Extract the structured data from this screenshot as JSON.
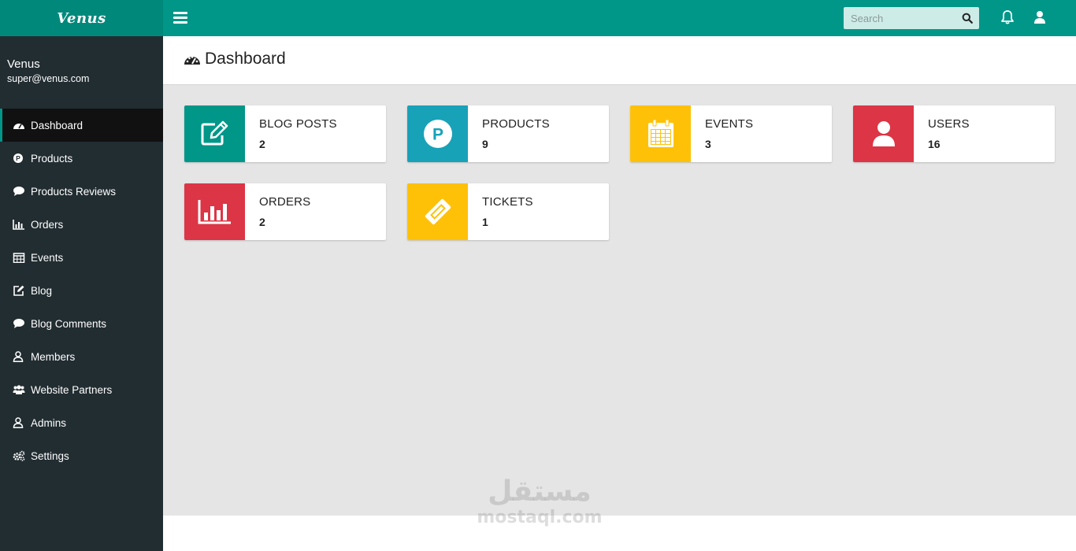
{
  "app": {
    "brand": "Venus"
  },
  "topbar": {
    "search_placeholder": "Search",
    "icons": [
      "menu-icon",
      "search-icon",
      "bell-icon",
      "user-icon"
    ]
  },
  "sidebar": {
    "user_name": "Venus",
    "user_email": "super@venus.com",
    "items": [
      {
        "label": "Dashboard",
        "icon": "dashboard-icon",
        "active": true
      },
      {
        "label": "Products",
        "icon": "product-icon"
      },
      {
        "label": "Products Reviews",
        "icon": "comment-icon"
      },
      {
        "label": "Orders",
        "icon": "chart-icon"
      },
      {
        "label": "Events",
        "icon": "calendar-icon"
      },
      {
        "label": "Blog",
        "icon": "edit-icon"
      },
      {
        "label": "Blog Comments",
        "icon": "comment-icon"
      },
      {
        "label": "Members",
        "icon": "user-icon"
      },
      {
        "label": "Website Partners",
        "icon": "users-icon"
      },
      {
        "label": "Admins",
        "icon": "user-icon"
      },
      {
        "label": "Settings",
        "icon": "gears-icon"
      }
    ]
  },
  "page": {
    "title": "Dashboard"
  },
  "cards": [
    {
      "label": "BLOG POSTS",
      "value": "2",
      "color": "#009688",
      "icon": "edit-icon"
    },
    {
      "label": "PRODUCTS",
      "value": "9",
      "color": "#17a2b8",
      "icon": "product-icon"
    },
    {
      "label": "EVENTS",
      "value": "3",
      "color": "#ffc107",
      "icon": "calendar-icon"
    },
    {
      "label": "USERS",
      "value": "16",
      "color": "#dc3545",
      "icon": "user-icon"
    },
    {
      "label": "ORDERS",
      "value": "2",
      "color": "#dc3545",
      "icon": "chart-icon"
    },
    {
      "label": "TICKETS",
      "value": "1",
      "color": "#ffc107",
      "icon": "ticket-icon"
    }
  ],
  "watermark": {
    "line1": "مستقل",
    "line2": "mostaql.com"
  }
}
